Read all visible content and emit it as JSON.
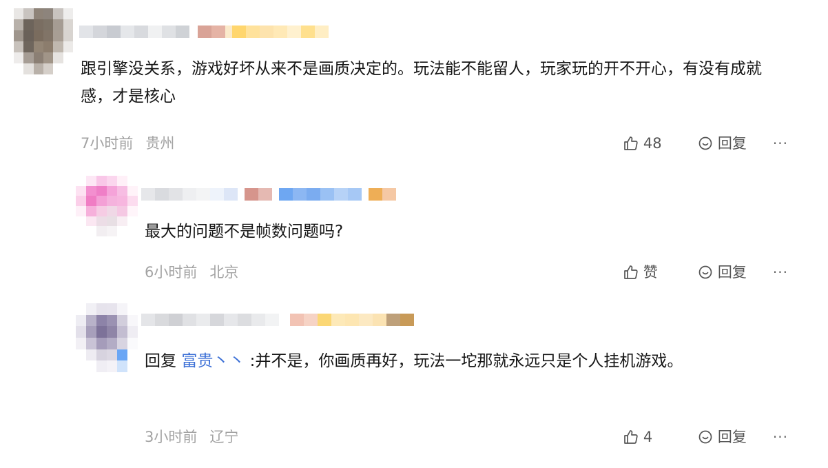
{
  "comments": [
    {
      "text": "跟引擎没关系，游戏好坏从来不是画质决定的。玩法能不能留人，玩家玩的开不开心，有没有成就感，才是核心",
      "time": "7小时前",
      "location": "贵州",
      "like_label": "48",
      "reply_label": "回复",
      "more_label": "···"
    },
    {
      "text": "最大的问题不是帧数问题吗?",
      "time": "6小时前",
      "location": "北京",
      "like_label": "赞",
      "reply_label": "回复",
      "more_label": "···"
    },
    {
      "reply_prefix": "回复",
      "mention": "富贵丶丶",
      "text": ":并不是，你画质再好，玩法一坨那就永远只是个人挂机游戏。",
      "time": "3小时前",
      "location": "辽宁",
      "like_label": "4",
      "reply_label": "回复",
      "more_label": "···"
    }
  ],
  "colors": {
    "text": "#161616",
    "meta": "#a3a3a3",
    "action": "#555555",
    "mention": "#3b6fd6"
  },
  "icons": [
    "thumbs-up-icon",
    "reply-bubble-icon",
    "more-icon"
  ]
}
